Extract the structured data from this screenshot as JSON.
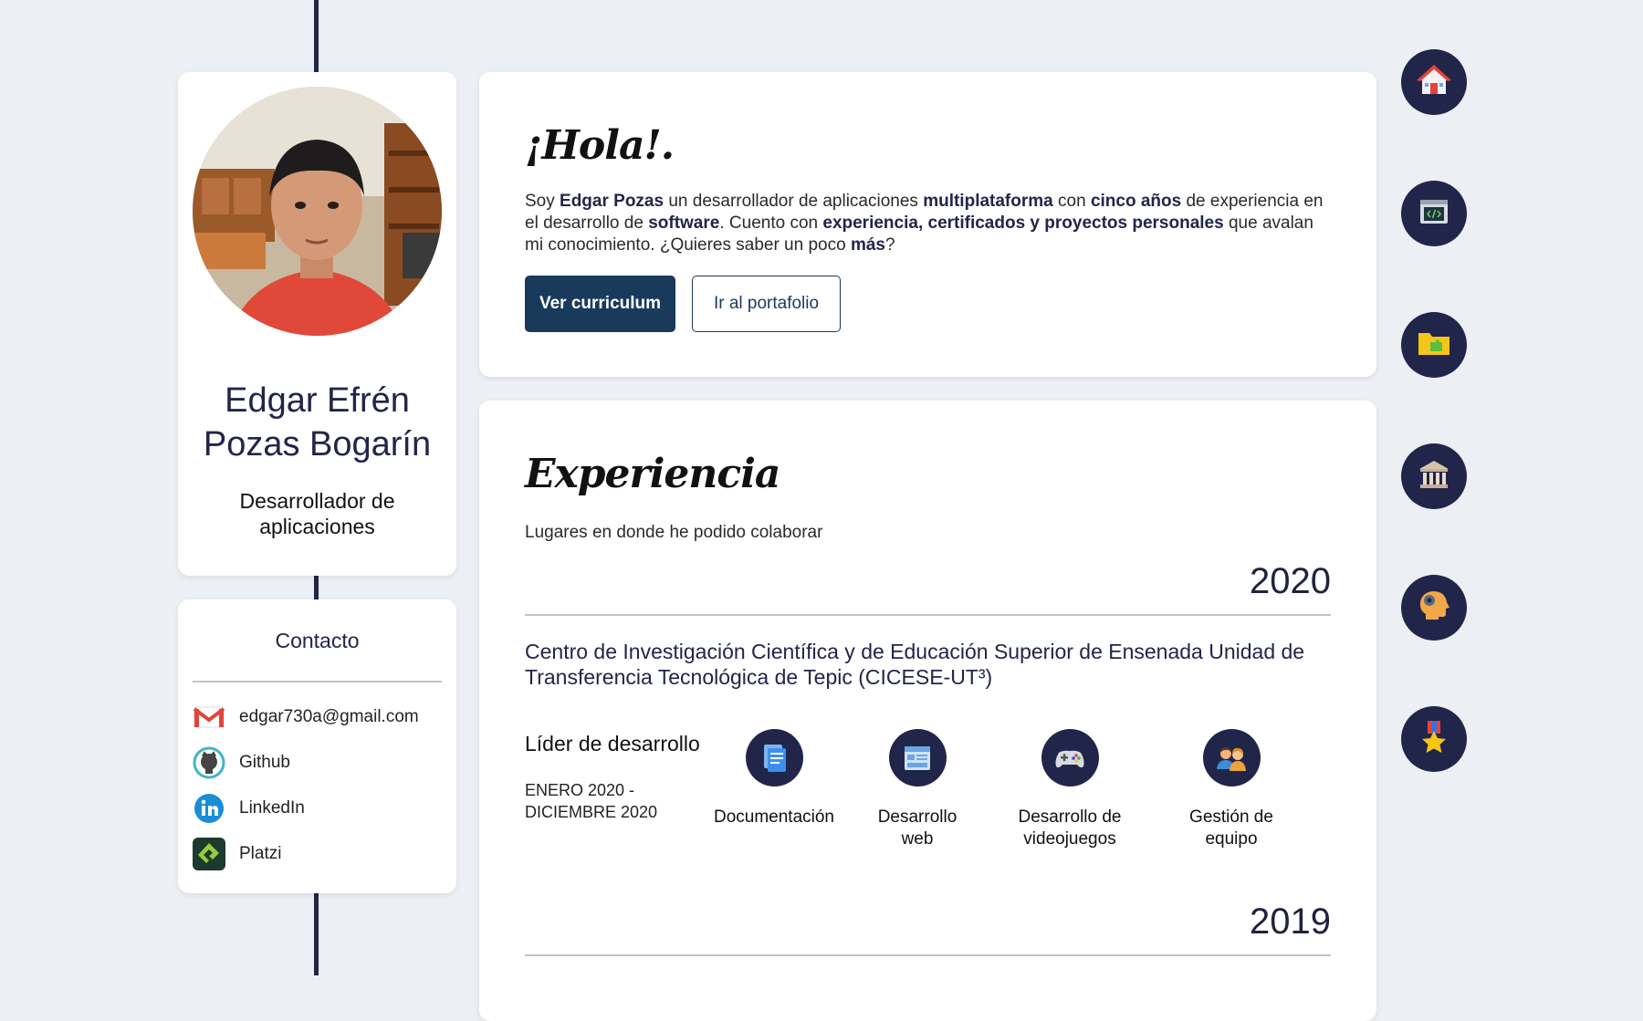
{
  "profile": {
    "name_line1": "Edgar Efrén",
    "name_line2": "Pozas Bogarín",
    "role_line1": "Desarrollador de",
    "role_line2": "aplicaciones"
  },
  "contact": {
    "title": "Contacto",
    "items": [
      {
        "label": "edgar730a@gmail.com",
        "icon": "gmail-icon"
      },
      {
        "label": "Github",
        "icon": "github-icon"
      },
      {
        "label": "LinkedIn",
        "icon": "linkedin-icon"
      },
      {
        "label": "Platzi",
        "icon": "platzi-icon"
      }
    ]
  },
  "hello": {
    "title": "¡Hola!.",
    "intro": {
      "t1": "Soy ",
      "b1": "Edgar Pozas",
      "t2": " un desarrollador de aplicaciones ",
      "b2": "multiplataforma",
      "t3": " con ",
      "b3": "cinco años",
      "t4": " de experiencia en el desarrollo de ",
      "b4": "software",
      "t5": ". Cuento con ",
      "b5": "experiencia, certificados y proyectos personales",
      "t6": " que avalan mi conocimiento. ¿Quieres saber un poco ",
      "b6": "más",
      "t7": "?"
    },
    "cv_button": "Ver curriculum",
    "portfolio_button": "Ir al portafolio"
  },
  "experience": {
    "title": "Experiencia",
    "subtitle": "Lugares en donde he podido colaborar",
    "entries": [
      {
        "year": "2020",
        "organization": "Centro de Investigación Científica y de Educación Superior de Ensenada Unidad de Transferencia Tecnológica de Tepic (CICESE-UT³)",
        "job_title": "Líder de desarrollo",
        "dates": "ENERO 2020 - DICIEMBRE 2020",
        "skills": [
          {
            "label": "Documentación",
            "icon": "document-icon"
          },
          {
            "label": "Desarrollo web",
            "icon": "web-window-icon"
          },
          {
            "label": "Desarrollo de videojuegos",
            "icon": "gamepad-icon"
          },
          {
            "label": "Gestión de equipo",
            "icon": "team-icon"
          }
        ]
      },
      {
        "year": "2019"
      }
    ]
  },
  "nav": [
    {
      "name": "home",
      "icon": "home-icon"
    },
    {
      "name": "code",
      "icon": "code-window-icon"
    },
    {
      "name": "portfolio",
      "icon": "folder-puzzle-icon"
    },
    {
      "name": "education",
      "icon": "institution-icon"
    },
    {
      "name": "skills",
      "icon": "head-gear-icon"
    },
    {
      "name": "achievements",
      "icon": "medal-icon"
    }
  ],
  "colors": {
    "background": "#eceff3",
    "navy": "#22254a",
    "primary_button": "#1a3a5c",
    "divider": "#bfc3c9"
  }
}
